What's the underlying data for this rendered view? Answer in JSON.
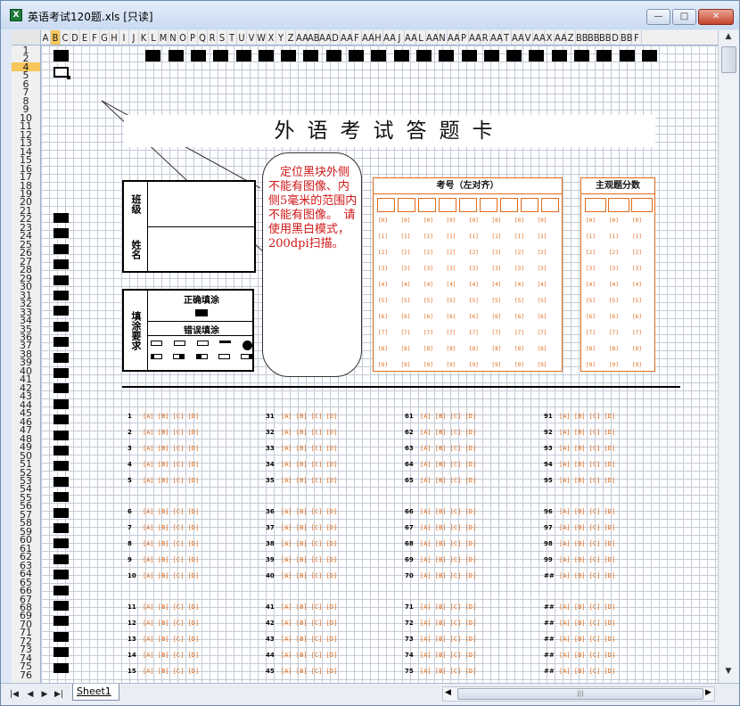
{
  "window": {
    "title": "英语考试120题.xls  [只读]",
    "app_icon": "excel-icon",
    "min": "—",
    "max": "□",
    "close": "✕"
  },
  "sheet": {
    "tab": "Sheet1",
    "scroll_grip": "|||"
  },
  "columns": [
    "A",
    "B",
    "C",
    "D",
    "E",
    "F",
    "G",
    "H",
    "I",
    "J",
    "K",
    "L",
    "M",
    "N",
    "O",
    "P",
    "Q",
    "R",
    "S",
    "T",
    "U",
    "V",
    "W",
    "X",
    "Y",
    "Z",
    "AA",
    "AB",
    "AA",
    "D",
    "AA",
    "F",
    "AA",
    "H",
    "AA",
    "J",
    "AA",
    "L",
    "AA",
    "N",
    "AA",
    "P",
    "AA",
    "R",
    "AA",
    "T",
    "AA",
    "V",
    "AA",
    "X",
    "AA",
    "Z",
    "BB",
    "BB",
    "BB",
    "D",
    "BB",
    "F"
  ],
  "rows": [
    "1",
    "2",
    "4",
    "5",
    "6",
    "7",
    "8",
    "9",
    "10",
    "11",
    "12",
    "13",
    "14",
    "15",
    "16",
    "17",
    "18",
    "19",
    "20",
    "21",
    "22",
    "23",
    "24",
    "25",
    "26",
    "27",
    "28",
    "29",
    "30",
    "31",
    "32",
    "33",
    "34",
    "35",
    "36",
    "37",
    "38",
    "39",
    "40",
    "41",
    "42",
    "43",
    "44",
    "45",
    "46",
    "47",
    "48",
    "49",
    "50",
    "51",
    "52",
    "53",
    "54",
    "55",
    "56",
    "57",
    "58",
    "59",
    "60",
    "61",
    "62",
    "63",
    "64",
    "65",
    "66",
    "67",
    "68",
    "69",
    "70",
    "71",
    "72",
    "73",
    "74",
    "75",
    "76"
  ],
  "card": {
    "title": "外语考试答题卡",
    "class_label": "班级",
    "name_label": "姓名",
    "fill_req_label": "填涂要求",
    "correct_label": "正确填涂",
    "wrong_label": "错误填涂",
    "note": "　定位黑块外侧不能有图像、内侧5毫米的范围内不能有图像。　请使用黑白模式，200dpi扫描。",
    "exam_no_label": "考号（左对齐）",
    "score_label": "主观题分数",
    "digits": [
      "[0]",
      "[1]",
      "[2]",
      "[3]",
      "[4]",
      "[5]",
      "[6]",
      "[7]",
      "[8]",
      "[9]"
    ],
    "options": "[A] [B] [C] [D]",
    "question_groups": [
      [
        "1",
        "2",
        "3",
        "4",
        "5"
      ],
      [
        "31",
        "32",
        "33",
        "34",
        "35"
      ],
      [
        "61",
        "62",
        "63",
        "64",
        "65"
      ],
      [
        "91",
        "92",
        "93",
        "94",
        "95"
      ],
      [
        "6",
        "7",
        "8",
        "9",
        "10"
      ],
      [
        "36",
        "37",
        "38",
        "39",
        "40"
      ],
      [
        "66",
        "67",
        "68",
        "69",
        "70"
      ],
      [
        "96",
        "97",
        "98",
        "99",
        "##"
      ],
      [
        "11",
        "12",
        "13",
        "14",
        "15"
      ],
      [
        "41",
        "42",
        "43",
        "44",
        "45"
      ],
      [
        "71",
        "72",
        "73",
        "74",
        "75"
      ],
      [
        "##",
        "##",
        "##",
        "##",
        "##"
      ]
    ]
  }
}
